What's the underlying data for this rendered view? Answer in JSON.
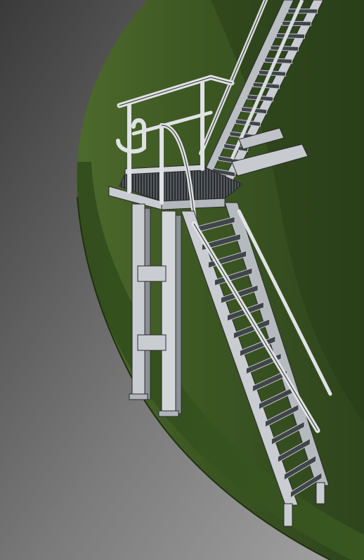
{
  "scene": {
    "subject": "steel-stair-landing-tank",
    "colors": {
      "tank_wall": "#3d5527",
      "tank_wall_light": "#4e6b2e",
      "tank_top": "#2f4420",
      "ground_dark": "#3a3a3a",
      "ground_light": "#9c9c9c",
      "steel": "#c9cdd2",
      "steel_dark": "#7e848a",
      "steel_edge": "#2b2b2b"
    }
  }
}
